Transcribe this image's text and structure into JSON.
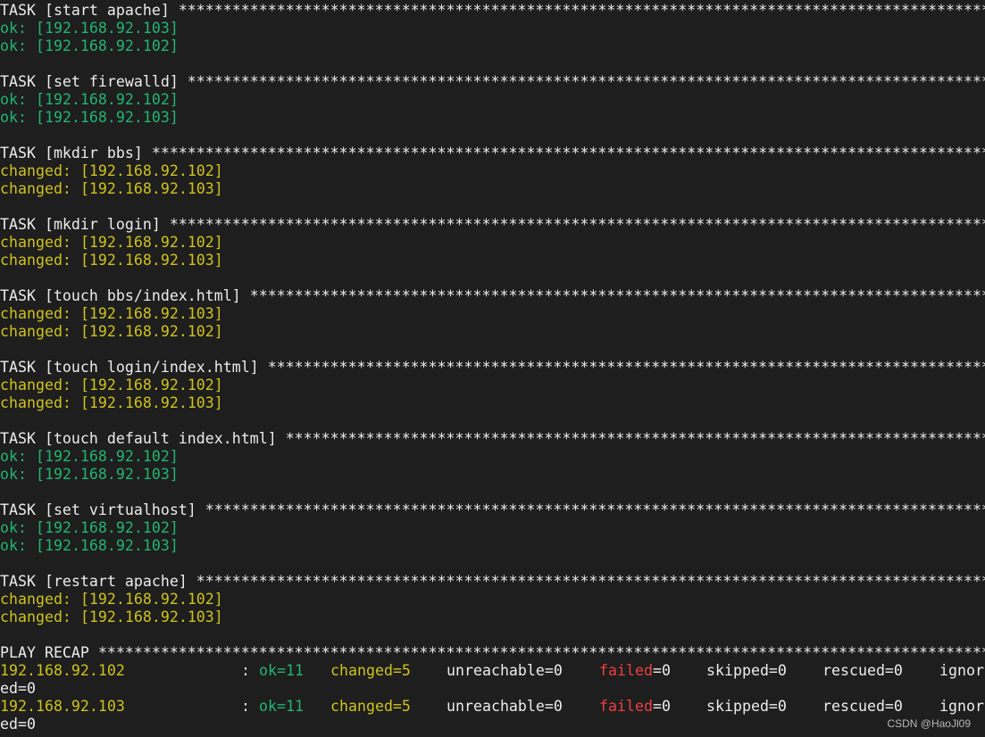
{
  "stars_char": "*",
  "tasks": [
    {
      "header": "TASK [start apache]",
      "results": [
        {
          "status": "ok:",
          "host": "[192.168.92.103]",
          "color": "green"
        },
        {
          "status": "ok:",
          "host": "[192.168.92.102]",
          "color": "green"
        }
      ]
    },
    {
      "header": "TASK [set firewalld]",
      "results": [
        {
          "status": "ok:",
          "host": "[192.168.92.102]",
          "color": "green"
        },
        {
          "status": "ok:",
          "host": "[192.168.92.103]",
          "color": "green"
        }
      ]
    },
    {
      "header": "TASK [mkdir bbs]",
      "results": [
        {
          "status": "changed:",
          "host": "[192.168.92.102]",
          "color": "yellow"
        },
        {
          "status": "changed:",
          "host": "[192.168.92.103]",
          "color": "yellow"
        }
      ]
    },
    {
      "header": "TASK [mkdir login]",
      "results": [
        {
          "status": "changed:",
          "host": "[192.168.92.102]",
          "color": "yellow"
        },
        {
          "status": "changed:",
          "host": "[192.168.92.103]",
          "color": "yellow"
        }
      ]
    },
    {
      "header": "TASK [touch bbs/index.html]",
      "results": [
        {
          "status": "changed:",
          "host": "[192.168.92.103]",
          "color": "yellow"
        },
        {
          "status": "changed:",
          "host": "[192.168.92.102]",
          "color": "yellow"
        }
      ]
    },
    {
      "header": "TASK [touch login/index.html]",
      "results": [
        {
          "status": "changed:",
          "host": "[192.168.92.102]",
          "color": "yellow"
        },
        {
          "status": "changed:",
          "host": "[192.168.92.103]",
          "color": "yellow"
        }
      ]
    },
    {
      "header": "TASK [touch default index.html]",
      "results": [
        {
          "status": "ok:",
          "host": "[192.168.92.102]",
          "color": "green"
        },
        {
          "status": "ok:",
          "host": "[192.168.92.103]",
          "color": "green"
        }
      ]
    },
    {
      "header": "TASK [set virtualhost]",
      "results": [
        {
          "status": "ok:",
          "host": "[192.168.92.102]",
          "color": "green"
        },
        {
          "status": "ok:",
          "host": "[192.168.92.103]",
          "color": "green"
        }
      ]
    },
    {
      "header": "TASK [restart apache]",
      "results": [
        {
          "status": "changed:",
          "host": "[192.168.92.102]",
          "color": "yellow"
        },
        {
          "status": "changed:",
          "host": "[192.168.92.103]",
          "color": "yellow"
        }
      ]
    }
  ],
  "recap": {
    "header": "PLAY RECAP",
    "rows": [
      {
        "host": "192.168.92.102",
        "sep": ":",
        "ok": "ok=11",
        "changed": "changed=5",
        "unreachable": "unreachable=0",
        "failed_label": "failed",
        "failed_value": "=0",
        "skipped": "skipped=0",
        "rescued": "rescued=0",
        "ignored_part1": "ignor",
        "ignored_part2": "ed=0"
      },
      {
        "host": "192.168.92.103",
        "sep": ":",
        "ok": "ok=11",
        "changed": "changed=5",
        "unreachable": "unreachable=0",
        "failed_label": "failed",
        "failed_value": "=0",
        "skipped": "skipped=0",
        "rescued": "rescued=0",
        "ignored_part1": "ignor",
        "ignored_part2": "ed=0"
      }
    ]
  },
  "watermark": "CSDN @HaoJl09",
  "colors": {
    "background": "#1e1e1e",
    "text": "#ececec",
    "ok": "#22b573",
    "changed": "#cfc31c",
    "failed": "#ef3f3f"
  }
}
